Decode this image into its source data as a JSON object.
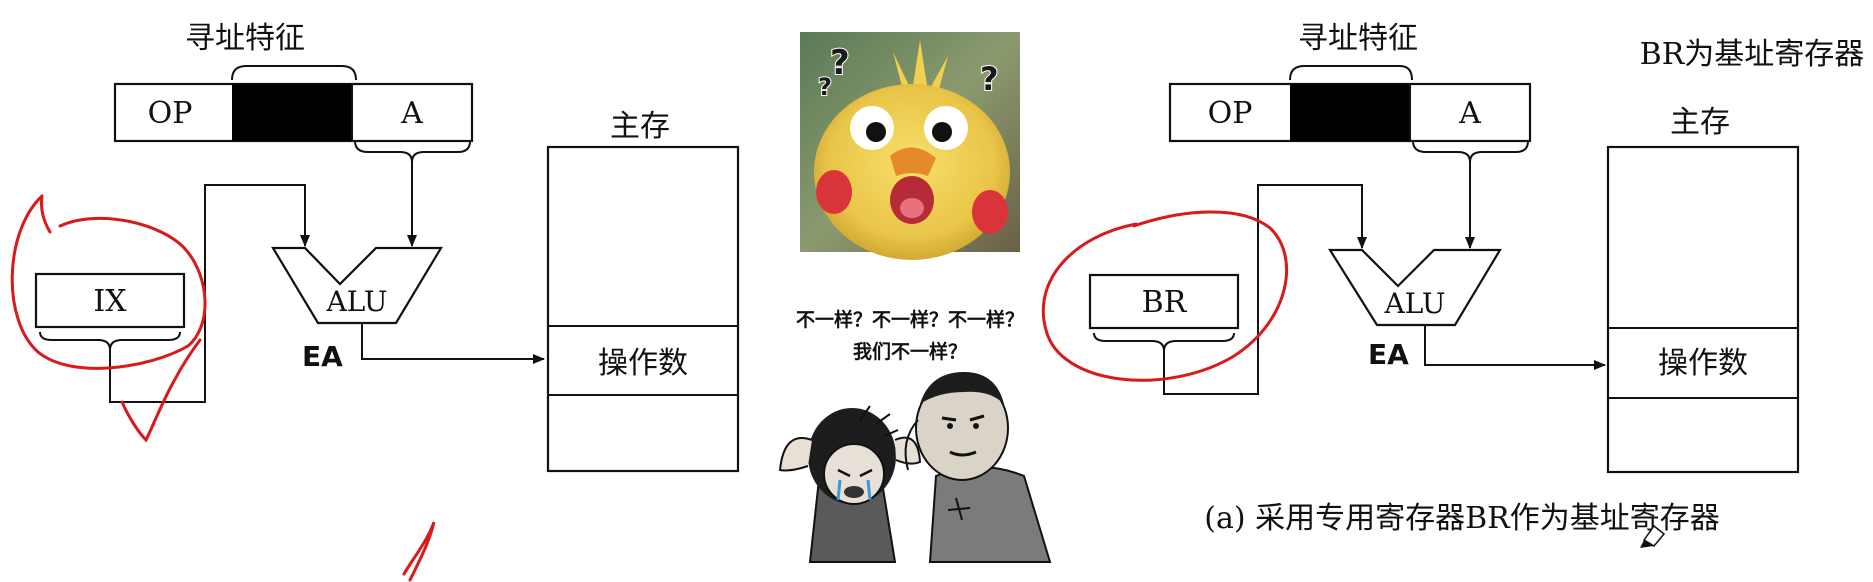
{
  "left_diagram": {
    "feature_label": "寻址特征",
    "op_label": "OP",
    "a_label": "A",
    "register_label": "IX",
    "alu_label": "ALU",
    "ea_label": "EA",
    "memory_title": "主存",
    "operand_label": "操作数"
  },
  "right_diagram": {
    "feature_label": "寻址特征",
    "op_label": "OP",
    "a_label": "A",
    "register_label": "BR",
    "alu_label": "ALU",
    "ea_label": "EA",
    "memory_title": "主存",
    "operand_label": "操作数",
    "note": "BR为基址寄存器",
    "caption": "(a) 采用专用寄存器BR作为基址寄存器"
  },
  "meme": {
    "caption_line1": "不一样？不一样？不一样？",
    "caption_line2": "我们不一样？",
    "question_marks": "?"
  },
  "colors": {
    "annotation_red": "#d91a1a",
    "instruction_black_field": "#000000"
  }
}
